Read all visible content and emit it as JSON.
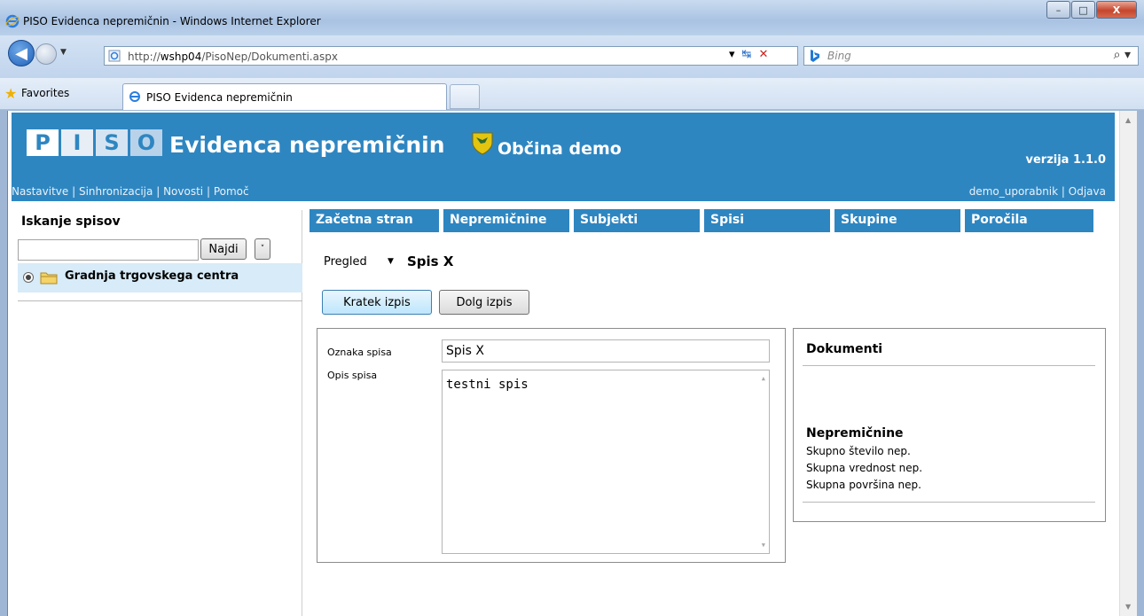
{
  "window": {
    "title": "PISO Evidenca nepremičnin - Windows Internet Explorer",
    "minimize": "–",
    "maximize": "□",
    "close": "X"
  },
  "browser": {
    "url_prefix": "http://",
    "url_host": "wshp04",
    "url_path": "/PisoNep/Dokumenti.aspx",
    "search_placeholder": "Bing",
    "favorites_label": "Favorites",
    "tab_label": "PISO Evidenca nepremičnin"
  },
  "header": {
    "logo_letters": [
      "P",
      "I",
      "S",
      "O"
    ],
    "app_title": "Evidenca nepremičnin",
    "municipality": "Občina demo",
    "version": "verzija 1.1.0",
    "links": [
      "Nastavitve",
      "Sinhronizacija",
      "Novosti",
      "Pomoč"
    ],
    "separator": "|",
    "user": "demo_uporabnik",
    "logout": "Odjava"
  },
  "sidebar": {
    "title": "Iskanje spisov",
    "search_value": "",
    "find_button": "Najdi",
    "more_button": "˅",
    "tree_item": "Gradnja trgovskega centra"
  },
  "nav": {
    "items": [
      "Začetna stran",
      "Nepremičnine",
      "Subjekti",
      "Spisi",
      "Skupine",
      "Poročila"
    ]
  },
  "main": {
    "view_select": "Pregled",
    "spis_title": "Spis X",
    "btn_short": "Kratek izpis",
    "btn_long": "Dolg izpis",
    "oznaka_label": "Oznaka spisa",
    "oznaka_value": "Spis X",
    "opis_label": "Opis spisa",
    "opis_value": "testni spis"
  },
  "right_panel": {
    "documents_title": "Dokumenti",
    "properties_title": "Nepremičnine",
    "lines": [
      "Skupno število nep.",
      "Skupna vrednost nep.",
      "Skupna površina nep."
    ]
  }
}
